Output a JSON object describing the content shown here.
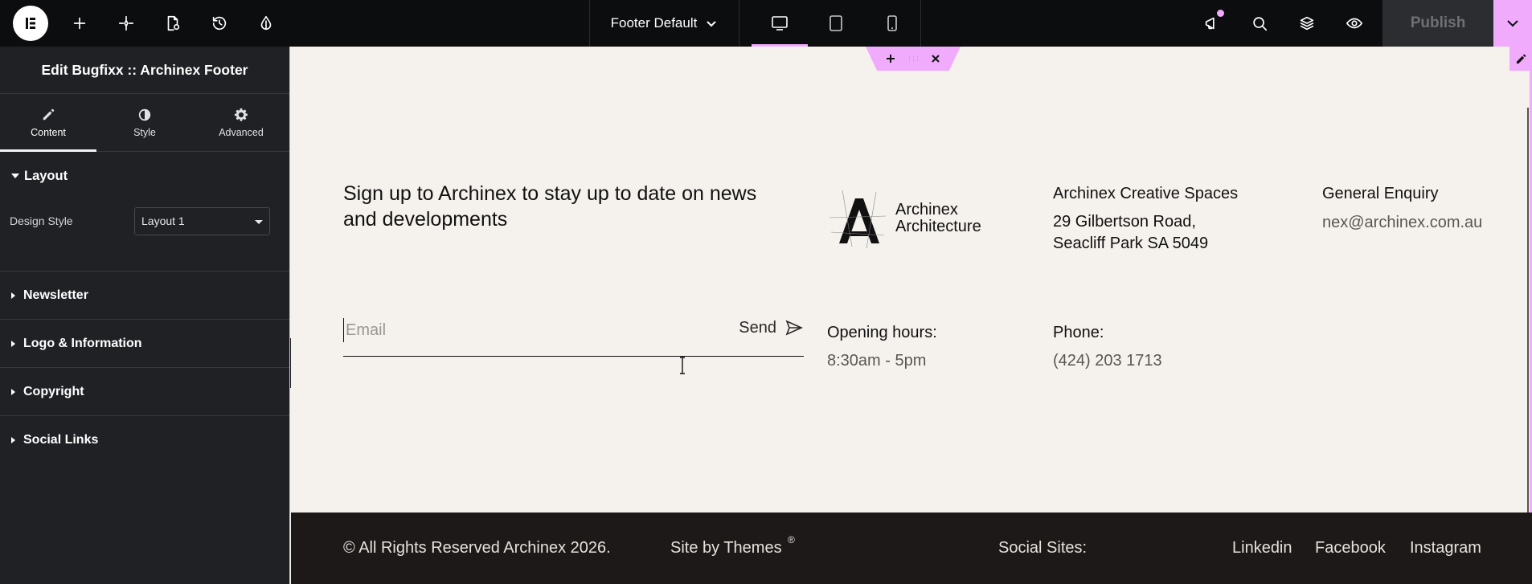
{
  "topbar": {
    "document_title": "Footer Default",
    "publish_label": "Publish"
  },
  "sidebar": {
    "title": "Edit Bugfixx :: Archinex Footer",
    "tabs": [
      {
        "label": "Content",
        "icon": "pencil-icon"
      },
      {
        "label": "Style",
        "icon": "half-circle-icon"
      },
      {
        "label": "Advanced",
        "icon": "gear-icon"
      }
    ],
    "layout_section": "Layout",
    "design_style_label": "Design Style",
    "design_style_value": "Layout 1",
    "sections": [
      "Newsletter",
      "Logo & Information",
      "Copyright",
      "Social Links"
    ]
  },
  "canvas": {
    "newsletter_text": "Sign up to Archinex to stay up to date on news and developments",
    "email_placeholder": "Email",
    "send_label": "Send",
    "brand_line1": "Archinex",
    "brand_line2": "Architecture",
    "office_title": "Archinex Creative Spaces",
    "office_address1": "29 Gilbertson Road,",
    "office_address2": "Seacliff Park SA 5049",
    "enquiry_title": "General Enquiry",
    "enquiry_email": "nex@archinex.com.au",
    "hours_title": "Opening hours:",
    "hours_value": "8:30am - 5pm",
    "phone_title": "Phone:",
    "phone_value": "(424) 203 1713"
  },
  "footer": {
    "copyright": "© All Rights Reserved Archinex 2026.",
    "site_by": "Site by Themes",
    "site_by_mark": "®",
    "social_label": "Social Sites:",
    "links": [
      "Linkedin",
      "Facebook",
      "Instagram"
    ]
  },
  "colors": {
    "accent": "#f0abfc",
    "topbar_bg": "#0c0d0e",
    "sidebar_bg": "#1f2124",
    "canvas_bg": "#f5f1ec",
    "footer_bg": "#1c1918"
  }
}
